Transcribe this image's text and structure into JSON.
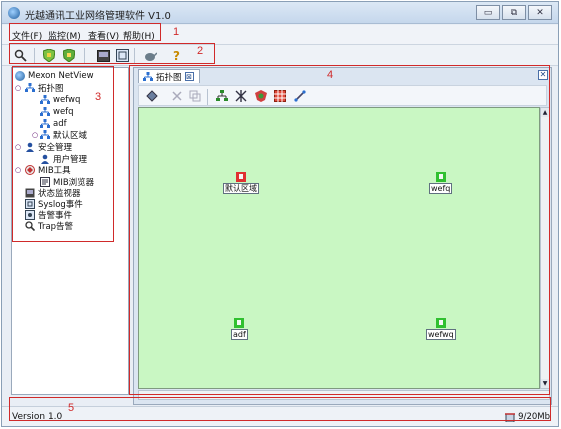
{
  "window": {
    "title": "光越通讯工业网络管理软件 V1.0",
    "controls": [
      "minimize",
      "restore",
      "close"
    ]
  },
  "menubar": {
    "items": [
      {
        "label": "文件(F)"
      },
      {
        "label": "监控(M)"
      },
      {
        "label": "查看(V)"
      },
      {
        "label": "帮助(H)"
      }
    ]
  },
  "toolbar": {
    "buttons": [
      {
        "icon": "search-icon"
      },
      {
        "icon": "green-shield-icon"
      },
      {
        "icon": "green-shield-2-icon"
      },
      {
        "icon": "monitor-icon"
      },
      {
        "icon": "document-icon"
      },
      {
        "icon": "teapot-icon"
      },
      {
        "icon": "help-icon"
      }
    ]
  },
  "tree": {
    "root": "Mexon NetView",
    "items": [
      {
        "label": "拓扑图",
        "icon": "topology-icon"
      },
      {
        "label": "wefwq",
        "icon": "topology-icon"
      },
      {
        "label": "wefq",
        "icon": "topology-icon"
      },
      {
        "label": "adf",
        "icon": "topology-icon"
      },
      {
        "label": "默认区域",
        "icon": "topology-icon"
      },
      {
        "label": "安全管理",
        "icon": "user-icon"
      },
      {
        "label": "用户管理",
        "icon": "user-icon"
      },
      {
        "label": "MIB工具",
        "icon": "mib-icon"
      },
      {
        "label": "MIB浏览器",
        "icon": "browser-icon"
      },
      {
        "label": "状态监视器",
        "icon": "monitor-icon"
      },
      {
        "label": "Syslog事件",
        "icon": "log-icon"
      },
      {
        "label": "告警事件",
        "icon": "alarm-icon"
      },
      {
        "label": "Trap告警",
        "icon": "trap-icon"
      }
    ]
  },
  "document": {
    "tab_label": "拓扑图",
    "tab_close": "⊠",
    "toolbar_icons": [
      "select-icon",
      "cut-icon",
      "copy-icon",
      "tree-layout-icon",
      "cross-icon",
      "shield-icon",
      "grid-icon",
      "link-icon"
    ],
    "nodes": [
      {
        "label": "默认区域",
        "status_color": "#e03030"
      },
      {
        "label": "wefq",
        "status_color": "#30c030"
      },
      {
        "label": "adf",
        "status_color": "#30c030"
      },
      {
        "label": "wefwq",
        "status_color": "#30c030"
      }
    ]
  },
  "annotations": [
    "1",
    "2",
    "3",
    "4",
    "5"
  ],
  "status": {
    "version": "Version 1.0",
    "memory": "9/20Mb"
  }
}
